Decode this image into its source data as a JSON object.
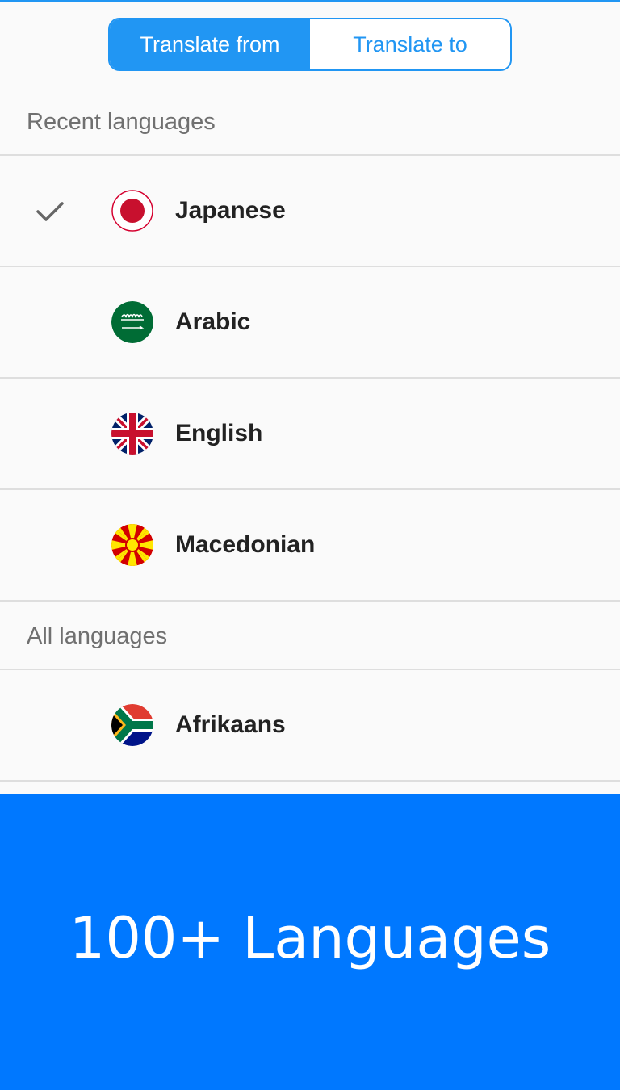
{
  "tabs": {
    "from_label": "Translate from",
    "to_label": "Translate to",
    "active": "from"
  },
  "sections": {
    "recent_header": "Recent languages",
    "all_header": "All languages"
  },
  "recent_languages": [
    {
      "name": "Japanese",
      "flag": "japan-flag-icon",
      "selected": true
    },
    {
      "name": "Arabic",
      "flag": "saudi-arabia-flag-icon",
      "selected": false
    },
    {
      "name": "English",
      "flag": "uk-flag-icon",
      "selected": false
    },
    {
      "name": "Macedonian",
      "flag": "macedonia-flag-icon",
      "selected": false
    }
  ],
  "all_languages": [
    {
      "name": "Afrikaans",
      "flag": "south-africa-flag-icon",
      "selected": false
    }
  ],
  "promo": {
    "text": "100+ Languages"
  },
  "colors": {
    "accent": "#2196f3",
    "promo_bg": "#0078ff",
    "background": "#fafafa"
  }
}
